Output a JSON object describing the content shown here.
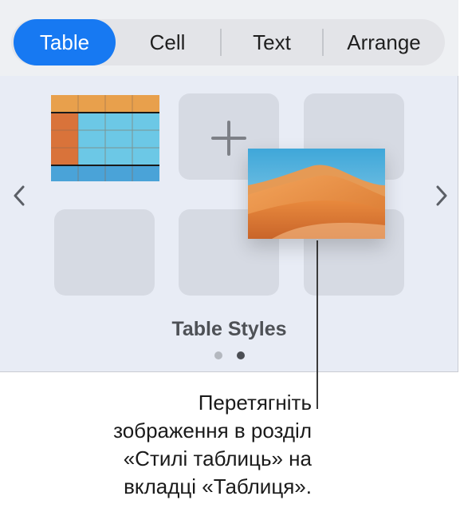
{
  "tabs": [
    {
      "label": "Table",
      "active": true
    },
    {
      "label": "Cell",
      "active": false
    },
    {
      "label": "Text",
      "active": false
    },
    {
      "label": "Arrange",
      "active": false
    }
  ],
  "gallery": {
    "section_title": "Table Styles",
    "add_icon": "plus-icon",
    "prev_icon": "chevron-left-icon",
    "next_icon": "chevron-right-icon",
    "pages": 2,
    "current_page": 2
  },
  "drag_image": {
    "description_icon": "desert-dunes-image"
  },
  "callout": {
    "lines": [
      "Перетягніть",
      "зображення в розділ",
      "«Стилі таблиць» на",
      "вкладці «Таблиця»."
    ]
  },
  "colors": {
    "accent": "#1779f2",
    "header_orange": "#e8a04c",
    "column_orange": "#d9733a",
    "cell_blue": "#6cc8e6",
    "footer_blue": "#4aa3d8"
  }
}
